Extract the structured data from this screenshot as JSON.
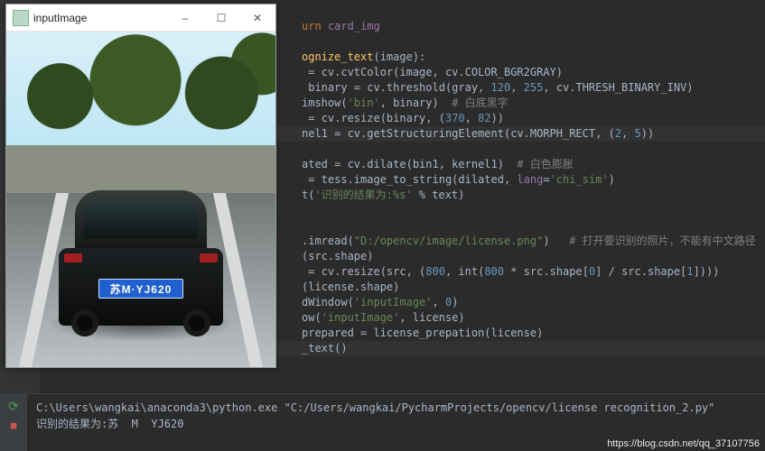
{
  "image_window": {
    "title": "inputImage",
    "plate_text": "苏M·YJ620",
    "min_label": "–",
    "max_label": "☐",
    "close_label": "✕"
  },
  "editor": {
    "lines": {
      "l0a": "urn",
      "l0b": " card_img",
      "l1a": "ognize_text",
      "l1b": "(image):",
      "l2a": " = cv.cvtColor(image",
      "l2b": ", ",
      "l2c": "cv.COLOR_BGR2GRAY)",
      "l3a": " binary = cv.threshold(gray",
      "l3b": ", ",
      "l3n1": "120",
      "l3c": ", ",
      "l3n2": "255",
      "l3d": ", ",
      "l3e": "cv.THRESH_BINARY_INV)",
      "l4a": "imshow(",
      "l4s": "'bin'",
      "l4b": ", ",
      "l4c": "binary)  ",
      "l4cm": "# 白底黑字",
      "l5a": " = cv.resize(binary",
      "l5b": ", ",
      "l5c": "(",
      "l5n1": "370",
      "l5d": ", ",
      "l5n2": "82",
      "l5e": "))",
      "l6a": "nel1 = cv.getStructuringElement(cv.MORPH_RECT",
      "l6b": ", ",
      "l6c": "(",
      "l6n1": "2",
      "l6d": ", ",
      "l6n2": "5",
      "l6e": "))",
      "l7a": "ated = cv.dilate(bin1",
      "l7b": ", ",
      "l7c": "kernel1)  ",
      "l7cm": "# 白色膨胀",
      "l8a": " = tess.image_to_string(dilated",
      "l8b": ", ",
      "l8c": "lang",
      "l8d": "=",
      "l8s": "'chi_sim'",
      "l8e": ")",
      "l9a": "t(",
      "l9s": "'识别的结果为:%s'",
      "l9b": " % text)",
      "l10a": ".imread(",
      "l10s": "\"D:/opencv/image/license.png\"",
      "l10b": ")   ",
      "l10cm": "# 打开要识别的照片，不能有中文路径",
      "l11a": "(src.shape)",
      "l12a": " = cv.resize(src",
      "l12b": ", ",
      "l12c": "(",
      "l12n1": "800",
      "l12d": ", ",
      "l12e": "int(",
      "l12n2": "800",
      "l12f": " * src.shape[",
      "l12n3": "0",
      "l12g": "] / src.shape[",
      "l12n4": "1",
      "l12h": "])))",
      "l13a": "(license.shape)",
      "l14a": "dWindow(",
      "l14s": "'inputImage'",
      "l14b": ", ",
      "l14n": "0",
      "l14c": ")",
      "l15a": "ow(",
      "l15s": "'inputImage'",
      "l15b": ", ",
      "l15c": "license)",
      "l16a": "prepared = license_prepation(license)",
      "l17a": "_text()"
    }
  },
  "console": {
    "line1a": "C:\\Users\\wangkai\\anaconda3\\python.exe ",
    "line1b": "\"C:/Users/wangkai/PycharmProjects/opencv/license recognition_2.py\"",
    "line2": "识别的结果为:苏  M  YJ620"
  },
  "watermark": "https://blog.csdn.net/qq_37107756"
}
